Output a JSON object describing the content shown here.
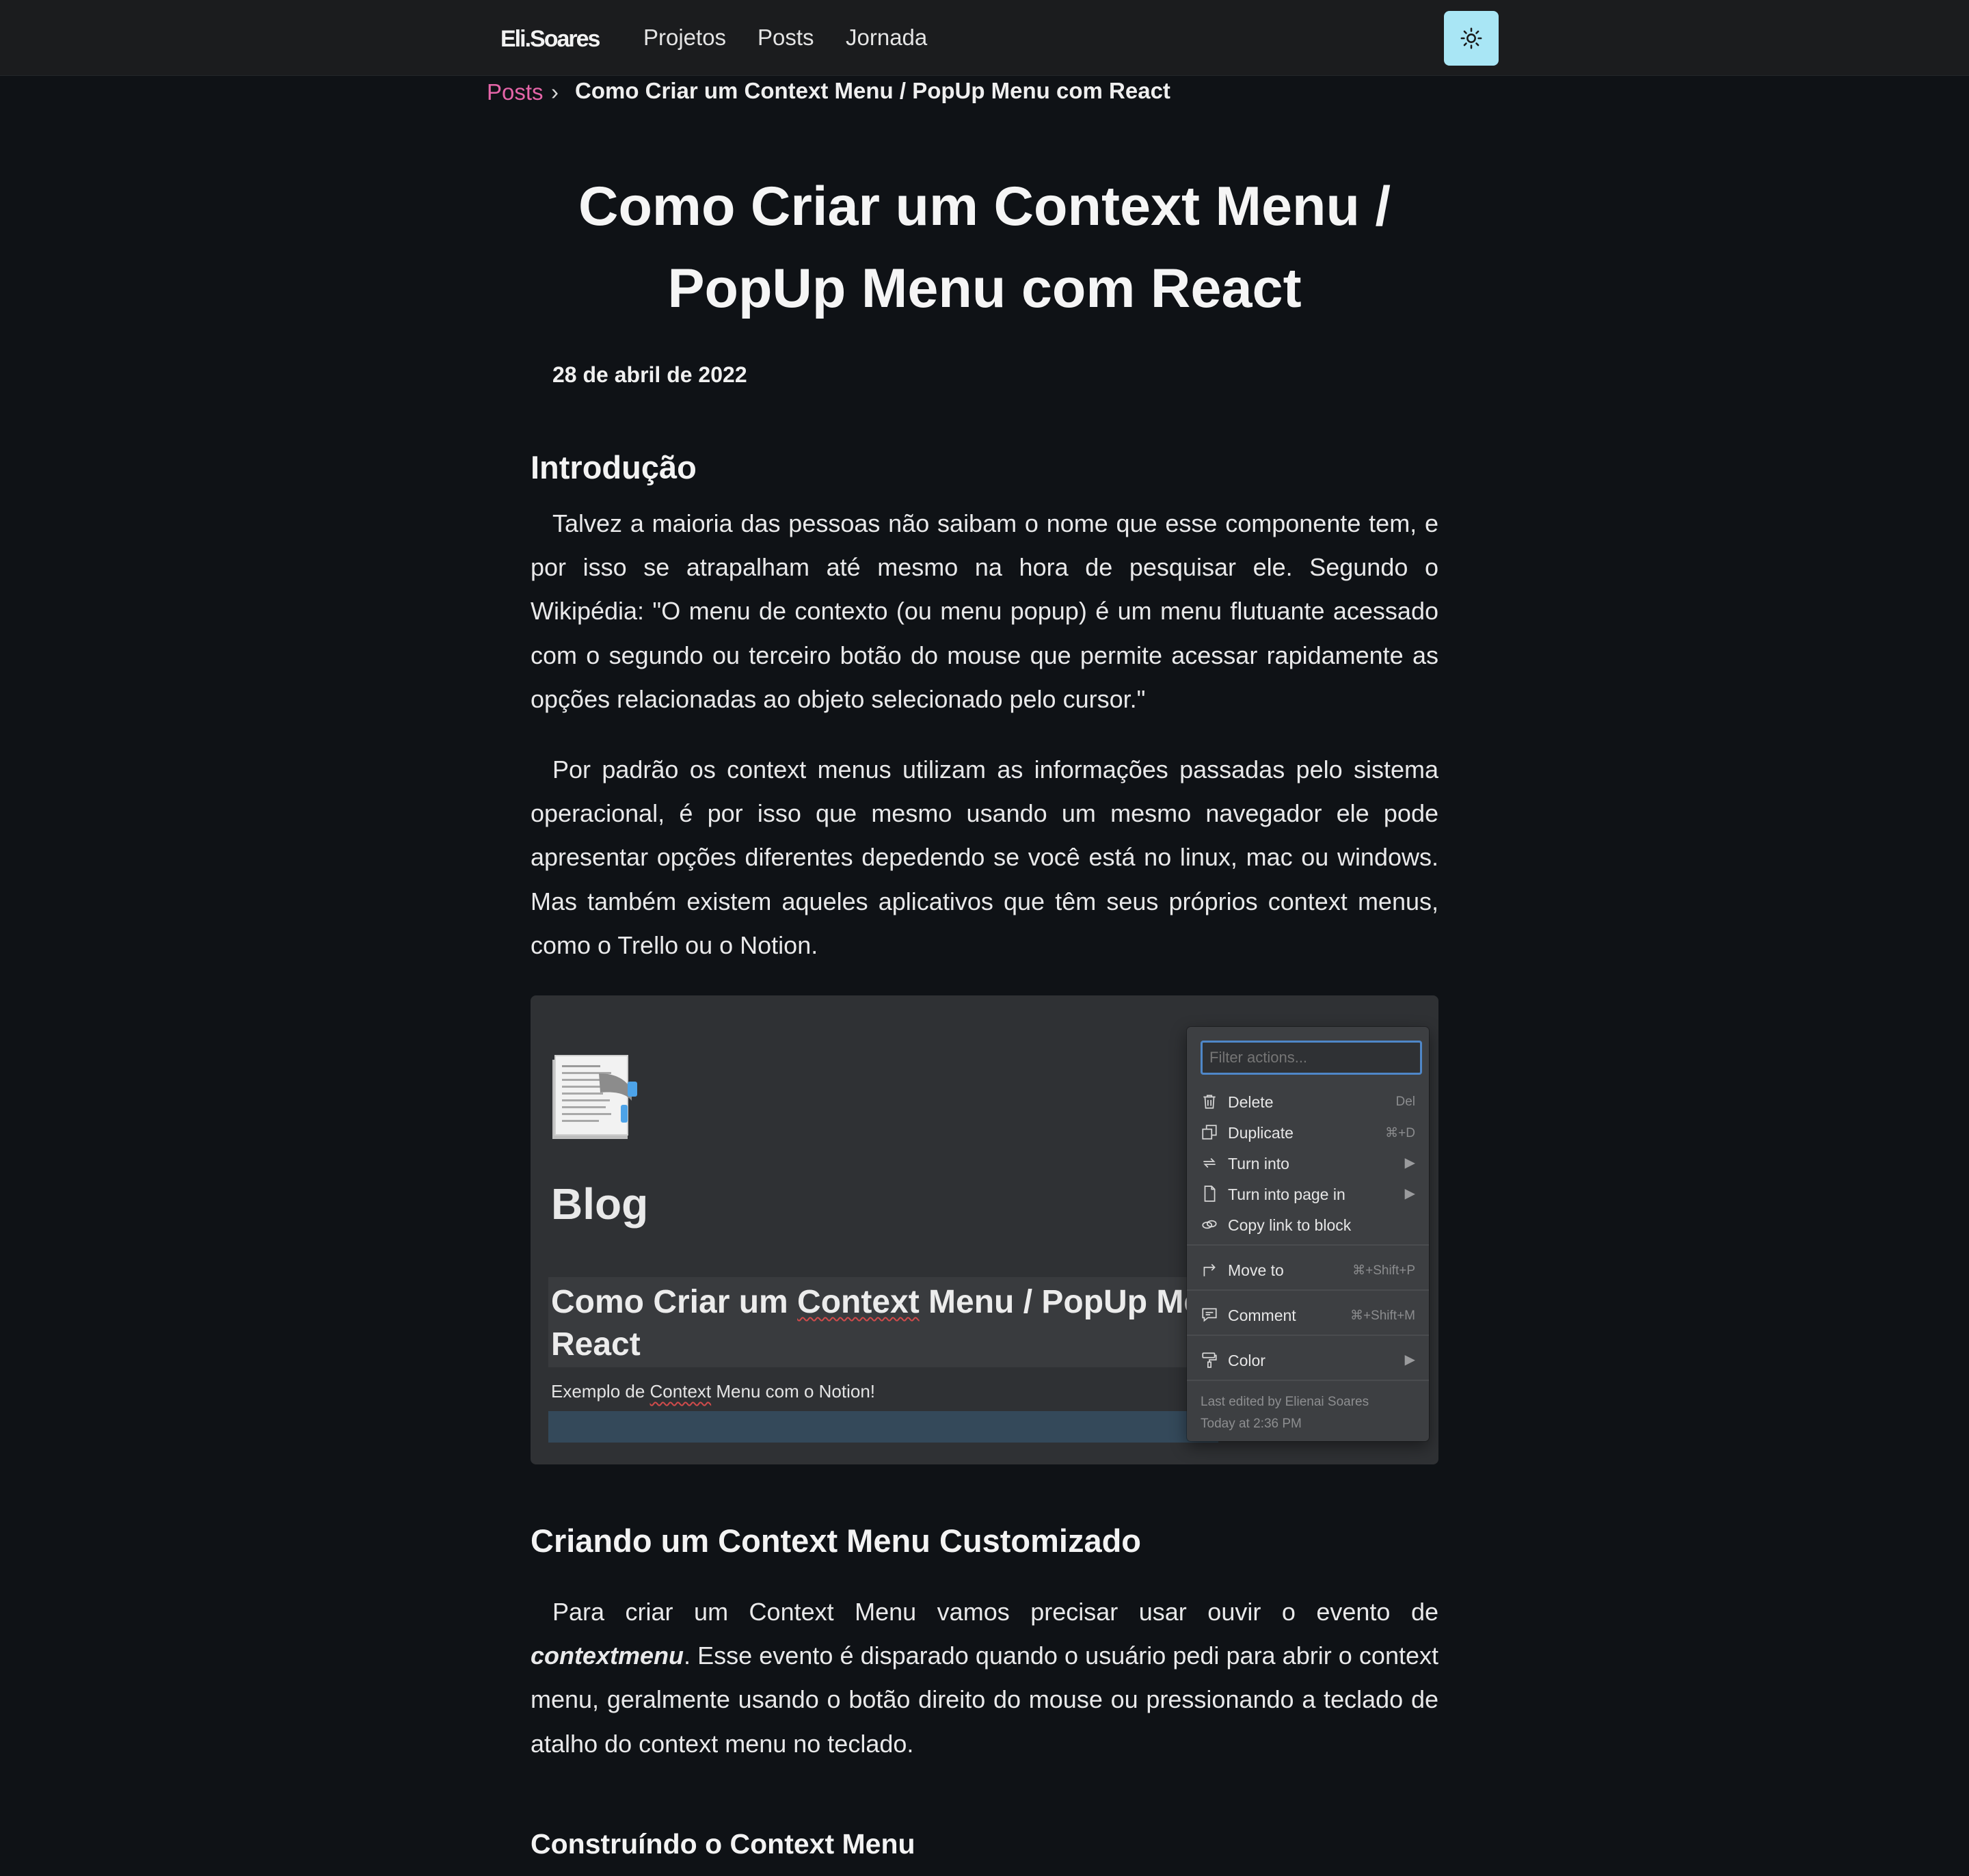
{
  "nav": {
    "brand": "Eli.Soares",
    "links": [
      "Projetos",
      "Posts",
      "Jornada"
    ],
    "theme_icon": "sun-icon",
    "theme_button_color": "#a9e6f5"
  },
  "breadcrumb": {
    "link": "Posts",
    "separator": "›",
    "current": "Como Criar um Context Menu / PopUp Menu com React",
    "link_color": "#e565a8"
  },
  "article": {
    "title_line1": "Como Criar um Context Menu /",
    "title_line2": "PopUp Menu com React",
    "date": "28 de abril de 2022",
    "intro_heading": "Introdução",
    "intro_p1": "Talvez a maioria das pessoas não saibam o nome que esse componente tem, e por isso se atrapalham até mesmo na hora de pesquisar ele. Segundo o Wikipédia: \"O menu de contexto (ou menu popup) é um menu flutuante acessado com o segundo ou terceiro botão do mouse que permite acessar rapidamente as opções relacionadas ao objeto selecionado pelo cursor.\"",
    "intro_p2": "Por padrão os context menus utilizam as informações passadas pelo sistema operacional, é por isso que mesmo usando um mesmo navegador ele pode apresentar opções diferentes depedendo se você está no linux, mac ou windows.   Mas também existem aqueles aplicativos que têm seus próprios context menus, como o Trello ou o Notion.",
    "section2_heading": "Criando um Context Menu Customizado",
    "section2_p_pre": "Para criar um Context Menu vamos precisar usar ouvir o evento de ",
    "section2_p_em": "contextmenu",
    "section2_p_post": ". Esse evento é disparado quando o usuário pedi para abrir o context menu, geralmente usando o botão direito do mouse ou pressionando a teclado de atalho do context menu no teclado.",
    "section3_heading": "Construíndo o Context Menu"
  },
  "screenshot": {
    "page_title": "Blog",
    "block_title_pre": "Como Criar um ",
    "block_title_squiggle": "Context",
    "block_title_post": " Menu / PopUp Men",
    "block_title_line2": "React",
    "block_sub_pre": "Exemplo de ",
    "block_sub_squiggle": "Context",
    "block_sub_post": " Menu com o Notion!",
    "menu": {
      "filter_placeholder": "Filter actions...",
      "items": [
        {
          "label": "Delete",
          "shortcut": "Del",
          "icon": "trash-icon"
        },
        {
          "label": "Duplicate",
          "shortcut": "⌘+D",
          "icon": "duplicate-icon"
        },
        {
          "label": "Turn into",
          "shortcut": "▶",
          "icon": "turn-into-icon"
        },
        {
          "label": "Turn into page in",
          "shortcut": "▶",
          "icon": "page-icon"
        },
        {
          "label": "Copy link to block",
          "shortcut": "",
          "icon": "link-icon"
        },
        {
          "label": "Move to",
          "shortcut": "⌘+Shift+P",
          "icon": "move-arrow-icon"
        },
        {
          "label": "Comment",
          "shortcut": "⌘+Shift+M",
          "icon": "comment-icon"
        },
        {
          "label": "Color",
          "shortcut": "▶",
          "icon": "paint-roller-icon"
        }
      ],
      "footer_line1": "Last edited by Elienai Soares",
      "footer_line2": "Today at 2:36 PM"
    }
  }
}
